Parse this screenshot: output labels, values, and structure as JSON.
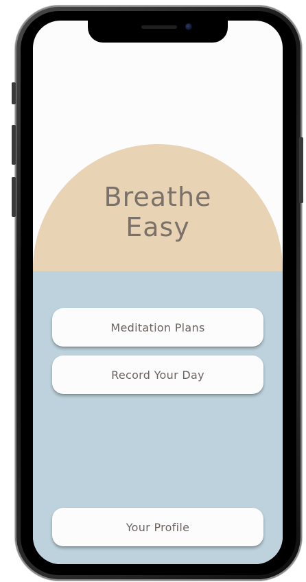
{
  "app": {
    "title_line1": "Breathe",
    "title_line2": "Easy"
  },
  "menu": {
    "meditation_label": "Meditation Plans",
    "record_label": "Record Your Day",
    "profile_label": "Your Profile"
  },
  "colors": {
    "hero_arc": "#e8d3b4",
    "lower_panel": "#bdd2dc",
    "button_bg": "#fcfcfc",
    "title_text": "#7a716b",
    "button_text": "#6b6360"
  }
}
